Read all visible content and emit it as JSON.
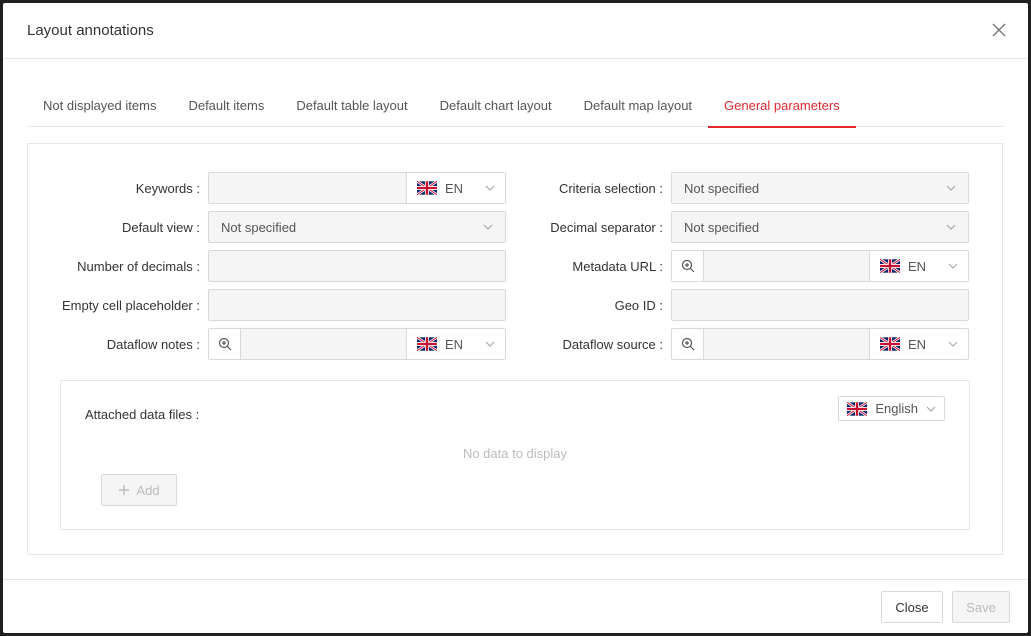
{
  "modal": {
    "title": "Layout annotations"
  },
  "tabs": [
    {
      "label": "Not displayed items"
    },
    {
      "label": "Default items"
    },
    {
      "label": "Default table layout"
    },
    {
      "label": "Default chart layout"
    },
    {
      "label": "Default map layout"
    },
    {
      "label": "General parameters"
    }
  ],
  "form": {
    "keywords": {
      "label": "Keywords",
      "lang": "EN",
      "value": ""
    },
    "criteria_selection": {
      "label": "Criteria selection",
      "value": "Not specified"
    },
    "default_view": {
      "label": "Default view",
      "value": "Not specified"
    },
    "decimal_separator": {
      "label": "Decimal separator",
      "value": "Not specified"
    },
    "number_of_decimals": {
      "label": "Number of decimals",
      "value": ""
    },
    "metadata_url": {
      "label": "Metadata URL",
      "lang": "EN",
      "value": ""
    },
    "empty_cell_placeholder": {
      "label": "Empty cell placeholder",
      "value": ""
    },
    "geo_id": {
      "label": "Geo ID",
      "value": ""
    },
    "dataflow_notes": {
      "label": "Dataflow notes",
      "lang": "EN",
      "value": ""
    },
    "dataflow_source": {
      "label": "Dataflow source",
      "lang": "EN",
      "value": ""
    }
  },
  "attached": {
    "label": "Attached data files",
    "language": "English",
    "empty_text": "No data to display",
    "add_label": "Add"
  },
  "footer": {
    "close_label": "Close",
    "save_label": "Save"
  },
  "colors": {
    "accent": "#e0282e",
    "border": "#d9d9d9",
    "disabled_bg": "#f5f5f5"
  }
}
